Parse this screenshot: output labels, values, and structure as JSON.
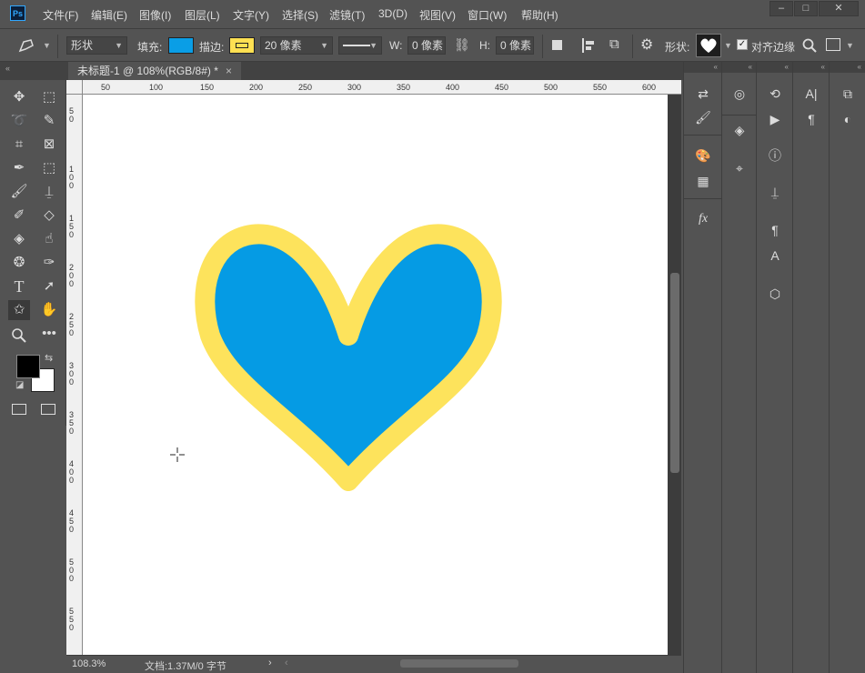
{
  "app": {
    "logo": "Ps"
  },
  "menubar": {
    "items": [
      "文件(F)",
      "编辑(E)",
      "图像(I)",
      "图层(L)",
      "文字(Y)",
      "选择(S)",
      "滤镜(T)",
      "3D(D)",
      "视图(V)",
      "窗口(W)",
      "帮助(H)"
    ],
    "window_buttons": [
      "minimize-icon",
      "maximize-icon",
      "close-icon"
    ]
  },
  "options_bar": {
    "tool_icon": "pen-shape-icon",
    "mode_value": "形状",
    "fill_label": "填充:",
    "fill_color": "#0a9ee6",
    "stroke_label": "描边:",
    "stroke_color": "#ffe052",
    "stroke_width": "20 像素",
    "w_label": "W:",
    "w_value": "0 像素",
    "h_label": "H:",
    "h_value": "0 像素",
    "shape_label": "形状:",
    "shape_preview": "heart",
    "align_edges_label": "对齐边缘",
    "align_edges_checked": true
  },
  "document": {
    "tab_title": "未标题-1 @ 108%(RGB/8#) *",
    "tab_close": "×",
    "ruler_top_labels": [
      "50",
      "100",
      "150",
      "200",
      "250",
      "300",
      "350",
      "400",
      "450",
      "500",
      "550",
      "600"
    ],
    "ruler_left_labels": [
      "50",
      "100",
      "150",
      "200",
      "250",
      "300",
      "350",
      "400",
      "450",
      "500",
      "550"
    ],
    "heart": {
      "fill": "#059be4",
      "stroke": "#fde35c"
    }
  },
  "status": {
    "zoom": "108.3%",
    "doc_info": "文档:1.37M/0 字节",
    "arrow": "›"
  },
  "colors": {
    "foreground": "#000000",
    "background": "#ffffff"
  }
}
